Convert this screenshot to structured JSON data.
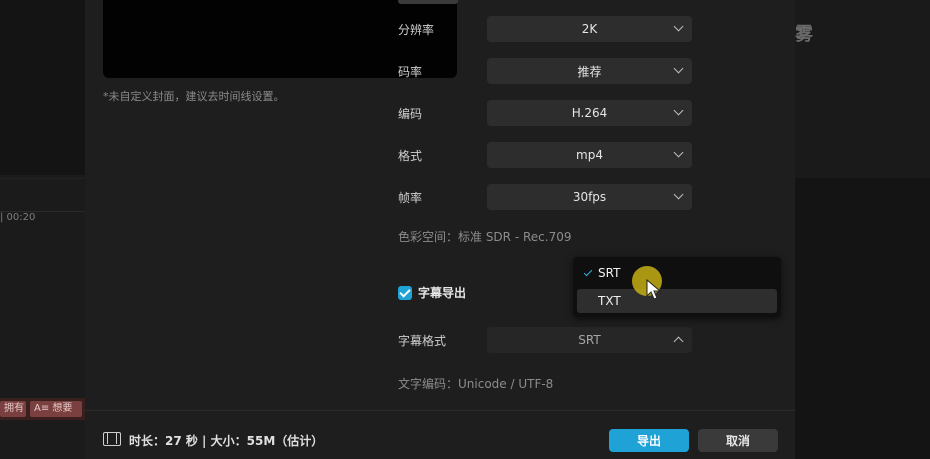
{
  "background": {
    "timeline_time": "| 00:20",
    "clips": [
      "拥有",
      "A≡ 想要"
    ],
    "right_title": "雾"
  },
  "preview": {
    "cover_note": "*未自定义封面，建议去时间线设置。"
  },
  "settings": {
    "resolution": {
      "label": "分辨率",
      "value": "2K"
    },
    "bitrate": {
      "label": "码率",
      "value": "推荐"
    },
    "codec": {
      "label": "编码",
      "value": "H.264"
    },
    "format": {
      "label": "格式",
      "value": "mp4"
    },
    "framerate": {
      "label": "帧率",
      "value": "30fps"
    },
    "color_space": "色彩空间：标准 SDR - Rec.709"
  },
  "subtitle": {
    "export_label": "字幕导出",
    "export_checked": true,
    "format_label": "字幕格式",
    "format_value": "SRT",
    "dropdown_options": [
      "SRT",
      "TXT"
    ],
    "dropdown_selected": "SRT",
    "encoding": "文字编码：Unicode / UTF-8"
  },
  "footer": {
    "summary": "时长：27 秒 | 大小：55M（估计）",
    "export_button": "导出",
    "cancel_button": "取消"
  },
  "colors": {
    "accent": "#1fa3d6",
    "cursor_halo": "#c4af14",
    "modal_bg": "#1e1e1e"
  }
}
